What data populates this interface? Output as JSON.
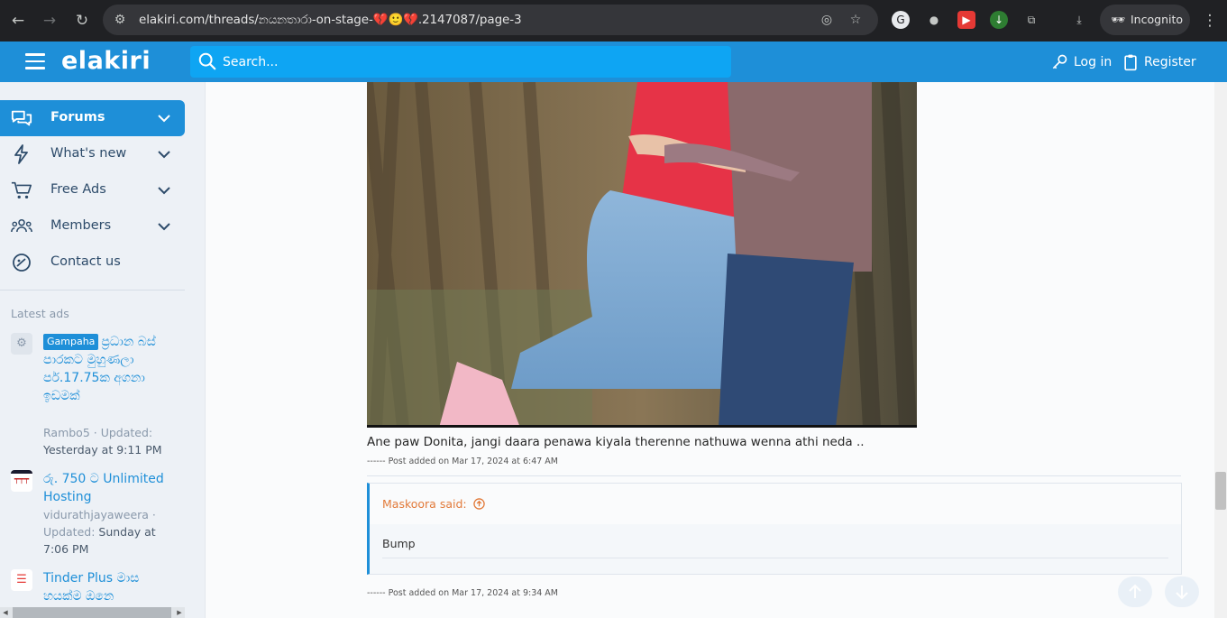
{
  "browser": {
    "url": "elakiri.com/threads/නයනතාරා-on-stage-💔🙂💔.2147087/page-3",
    "incognito_label": "Incognito"
  },
  "header": {
    "logo": "elakiri",
    "search_placeholder": "Search...",
    "login_label": "Log in",
    "register_label": "Register"
  },
  "sidebar": {
    "items": [
      {
        "label": "Forums"
      },
      {
        "label": "What's new"
      },
      {
        "label": "Free Ads"
      },
      {
        "label": "Members"
      },
      {
        "label": "Contact us"
      }
    ],
    "latest_ads_heading": "Latest ads",
    "ads": [
      {
        "badge": "Gampaha",
        "title": "ප්‍රධාන බස් පාරකට මුහුණලා පර්.17.75ක අගනා ඉඩමක්",
        "author": "Rambo5",
        "updated_prefix": " · Updated:",
        "updated": "Yesterday at 9:11 PM"
      },
      {
        "title": "රු. 750 ට Unlimited Hosting",
        "author": "vidurathjayaweera",
        "updated_prefix": " · Updated:",
        "updated": "Sunday at 7:06 PM"
      },
      {
        "title": "Tinder Plus මාස හයක්ම ඔනෙ"
      }
    ]
  },
  "post": {
    "caption": "Ane paw Donita, jangi daara penawa kiyala therenne nathuwa wenna athi neda ..",
    "sig_1": "------ Post added on Mar 17, 2024 at 6:47 AM",
    "quote_author": "Maskoora said:",
    "quote_body": "Bump",
    "sig_2": "------ Post added on Mar 17, 2024 at 9:34 AM"
  }
}
